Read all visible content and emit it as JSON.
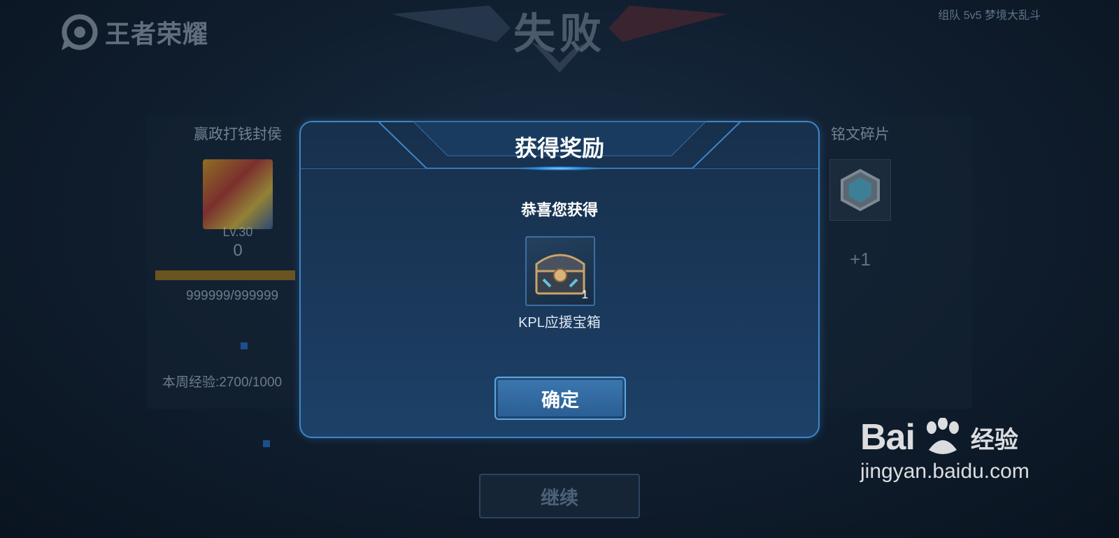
{
  "header": {
    "logo_text": "王者荣耀",
    "result_title": "失败",
    "mode_text": "组队 5v5 梦境大乱斗"
  },
  "background": {
    "player_name": "赢政打钱封侯",
    "level": "Lv.30",
    "score": "0",
    "exp_value": "999999/999999",
    "week_exp": "本周经验:2700/1000",
    "right_title": "铭文碎片",
    "right_amount": "+1",
    "continue_label": "继续"
  },
  "modal": {
    "title": "获得奖励",
    "congrats": "恭喜您获得",
    "item": {
      "name": "KPL应援宝箱",
      "count": "1",
      "icon": "treasure-chest-icon"
    },
    "confirm_label": "确定"
  },
  "watermark": {
    "brand": "Bai",
    "brand_suffix": "经验",
    "url": "jingyan.baidu.com"
  },
  "colors": {
    "modal_border": "#3f86c8",
    "button": "#2f6aa0",
    "background": "#0f1d2d"
  }
}
